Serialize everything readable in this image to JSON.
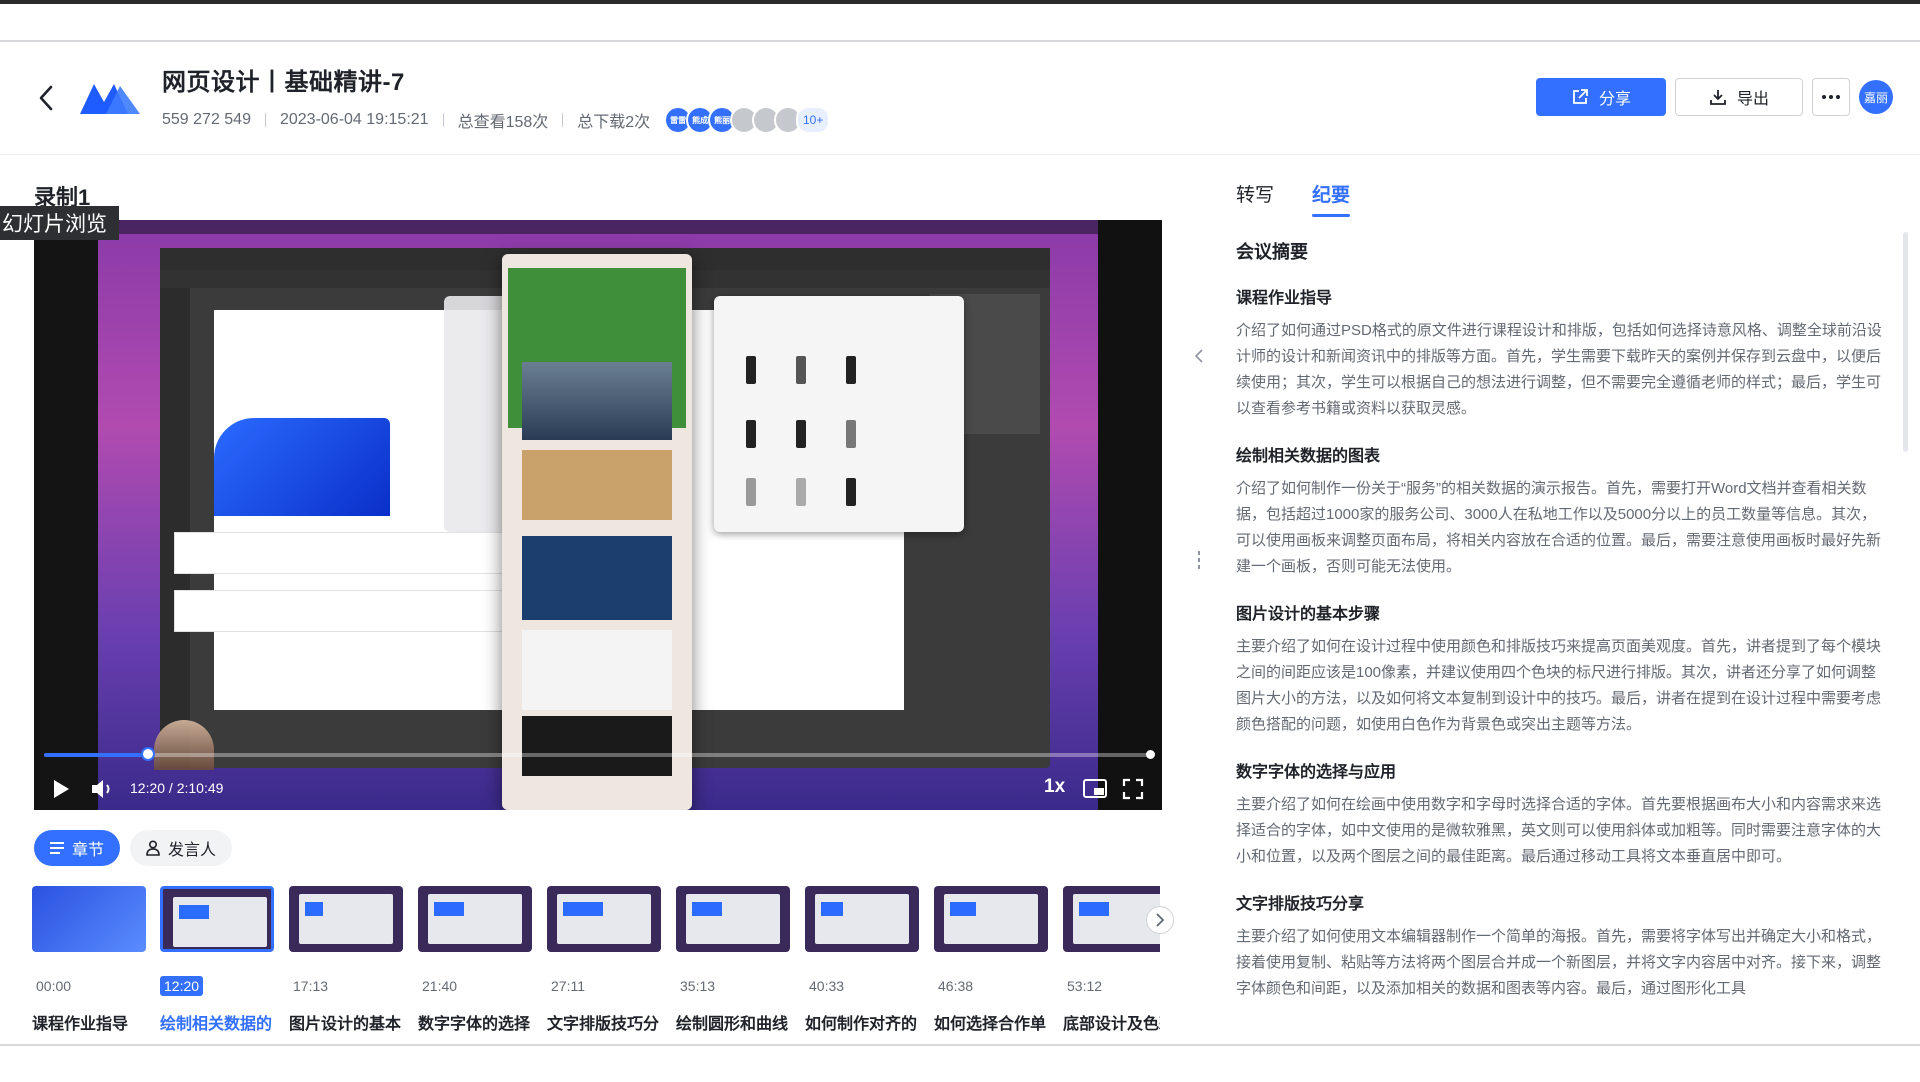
{
  "header": {
    "title": "网页设计丨基础精讲-7",
    "meeting_id": "559 272 549",
    "datetime": "2023-06-04 19:15:21",
    "views": "总查看158次",
    "downloads": "总下载2次",
    "viewer_avatars": [
      "雷雷",
      "熊成",
      "熊丽"
    ],
    "viewer_more": "10+",
    "share_label": "分享",
    "export_label": "导出",
    "user_avatar": "嘉丽"
  },
  "recording": {
    "label": "录制1",
    "slide_tag": "幻灯片浏览"
  },
  "player": {
    "time_display": "12:20 / 2:10:49",
    "progress": 0.094,
    "speed": "1x"
  },
  "filters": {
    "chapters_label": "章节",
    "speakers_label": "发言人"
  },
  "chapters": [
    {
      "time": "00:00",
      "title": "课程作业指导"
    },
    {
      "time": "12:20",
      "title": "绘制相关数据的"
    },
    {
      "time": "17:13",
      "title": "图片设计的基本"
    },
    {
      "time": "21:40",
      "title": "数字字体的选择"
    },
    {
      "time": "27:11",
      "title": "文字排版技巧分"
    },
    {
      "time": "35:13",
      "title": "绘制圆形和曲线"
    },
    {
      "time": "40:33",
      "title": "如何制作对齐的"
    },
    {
      "time": "46:38",
      "title": "如何选择合作单"
    },
    {
      "time": "53:12",
      "title": "底部设计及色彩"
    }
  ],
  "right_pane": {
    "tab_transcript": "转写",
    "tab_minutes": "纪要",
    "summary_title": "会议摘要",
    "sections": [
      {
        "heading": "课程作业指导",
        "body": "介绍了如何通过PSD格式的原文件进行课程设计和排版，包括如何选择诗意风格、调整全球前沿设计师的设计和新闻资讯中的排版等方面。首先，学生需要下载昨天的案例并保存到云盘中，以便后续使用；其次，学生可以根据自己的想法进行调整，但不需要完全遵循老师的样式；最后，学生可以查看参考书籍或资料以获取灵感。"
      },
      {
        "heading": "绘制相关数据的图表",
        "body": "介绍了如何制作一份关于“服务”的相关数据的演示报告。首先，需要打开Word文档并查看相关数据，包括超过1000家的服务公司、3000人在私地工作以及5000分以上的员工数量等信息。其次，可以使用画板来调整页面布局，将相关内容放在合适的位置。最后，需要注意使用画板时最好先新建一个画板，否则可能无法使用。"
      },
      {
        "heading": "图片设计的基本步骤",
        "body": "主要介绍了如何在设计过程中使用颜色和排版技巧来提高页面美观度。首先，讲者提到了每个模块之间的间距应该是100像素，并建议使用四个色块的标尺进行排版。其次，讲者还分享了如何调整图片大小的方法，以及如何将文本复制到设计中的技巧。最后，讲者在提到在设计过程中需要考虑颜色搭配的问题，如使用白色作为背景色或突出主题等方法。"
      },
      {
        "heading": "数字字体的选择与应用",
        "body": "主要介绍了如何在绘画中使用数字和字母时选择合适的字体。首先要根据画布大小和内容需求来选择适合的字体，如中文使用的是微软雅黑，英文则可以使用斜体或加粗等。同时需要注意字体的大小和位置，以及两个图层之间的最佳距离。最后通过移动工具将文本垂直居中即可。"
      },
      {
        "heading": "文字排版技巧分享",
        "body": "主要介绍了如何使用文本编辑器制作一个简单的海报。首先，需要将字体写出并确定大小和格式，接着使用复制、粘贴等方法将两个图层合并成一个新图层，并将文字内容居中对齐。接下来，调整字体颜色和间距，以及添加相关的数据和图表等内容。最后，通过图形化工具"
      }
    ]
  },
  "colors": {
    "accent": "#3370ff",
    "text": "#1f2329",
    "muted": "#646a73"
  }
}
